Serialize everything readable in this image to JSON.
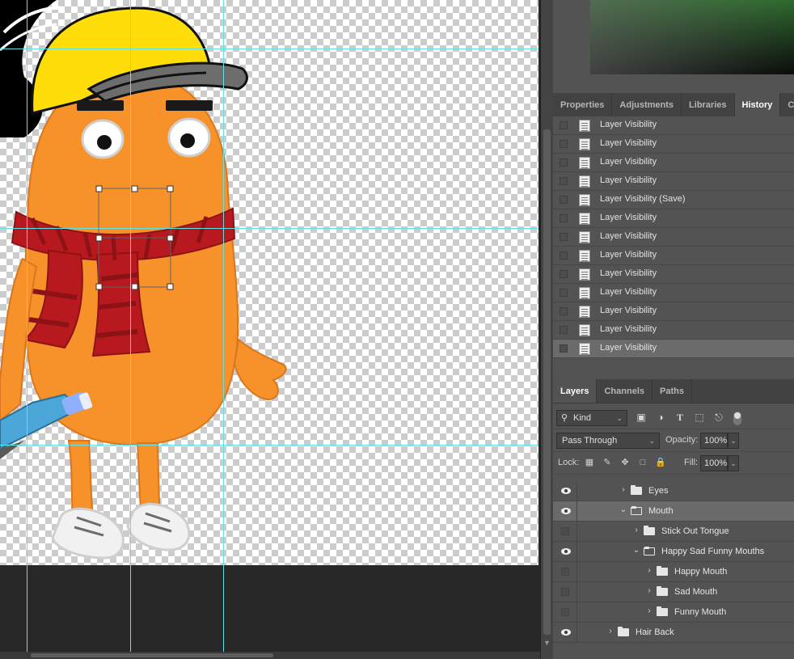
{
  "panels": {
    "top_tabs": [
      {
        "label": "Properties",
        "active": false
      },
      {
        "label": "Adjustments",
        "active": false
      },
      {
        "label": "Libraries",
        "active": false
      },
      {
        "label": "History",
        "active": true
      },
      {
        "label": "Comme",
        "active": false
      }
    ],
    "history": [
      {
        "label": "Layer Visibility"
      },
      {
        "label": "Layer Visibility"
      },
      {
        "label": "Layer Visibility"
      },
      {
        "label": "Layer Visibility"
      },
      {
        "label": "Layer Visibility (Save)"
      },
      {
        "label": "Layer Visibility"
      },
      {
        "label": "Layer Visibility"
      },
      {
        "label": "Layer Visibility"
      },
      {
        "label": "Layer Visibility"
      },
      {
        "label": "Layer Visibility"
      },
      {
        "label": "Layer Visibility"
      },
      {
        "label": "Layer Visibility"
      },
      {
        "label": "Layer Visibility",
        "selected": true
      }
    ],
    "bottom_tabs": [
      {
        "label": "Layers",
        "active": true
      },
      {
        "label": "Channels",
        "active": false
      },
      {
        "label": "Paths",
        "active": false
      }
    ]
  },
  "layers_controls": {
    "filter_kind": "Kind",
    "filter_icons": [
      "image-filter-icon",
      "adjustment-filter-icon",
      "type-filter-icon",
      "shape-filter-icon",
      "smart-object-filter-icon"
    ],
    "blend_mode": "Pass Through",
    "opacity_label": "Opacity:",
    "opacity_value": "100%",
    "lock_label": "Lock:",
    "fill_label": "Fill:",
    "fill_value": "100%"
  },
  "layers": [
    {
      "name": "Eyes",
      "visible": true,
      "expanded": false,
      "indent": 1,
      "selected": false
    },
    {
      "name": "Mouth",
      "visible": true,
      "expanded": true,
      "indent": 1,
      "selected": true
    },
    {
      "name": "Stick Out Tongue",
      "visible": false,
      "expanded": false,
      "indent": 2,
      "selected": false
    },
    {
      "name": "Happy Sad Funny Mouths",
      "visible": true,
      "expanded": true,
      "indent": 2,
      "selected": false
    },
    {
      "name": "Happy Mouth",
      "visible": false,
      "expanded": false,
      "indent": 3,
      "selected": false
    },
    {
      "name": "Sad Mouth",
      "visible": false,
      "expanded": false,
      "indent": 3,
      "selected": false
    },
    {
      "name": "Funny Mouth",
      "visible": false,
      "expanded": false,
      "indent": 3,
      "selected": false
    },
    {
      "name": "Hair Back",
      "visible": true,
      "expanded": false,
      "indent": 0,
      "selected": false
    }
  ],
  "colors": {
    "panel_bg": "#535353",
    "tab_bar": "#424242",
    "guide": "#5fe3e6",
    "character_orange": "#f7912a",
    "cap_yellow": "#fedd08",
    "scarf_red": "#b8191e"
  }
}
